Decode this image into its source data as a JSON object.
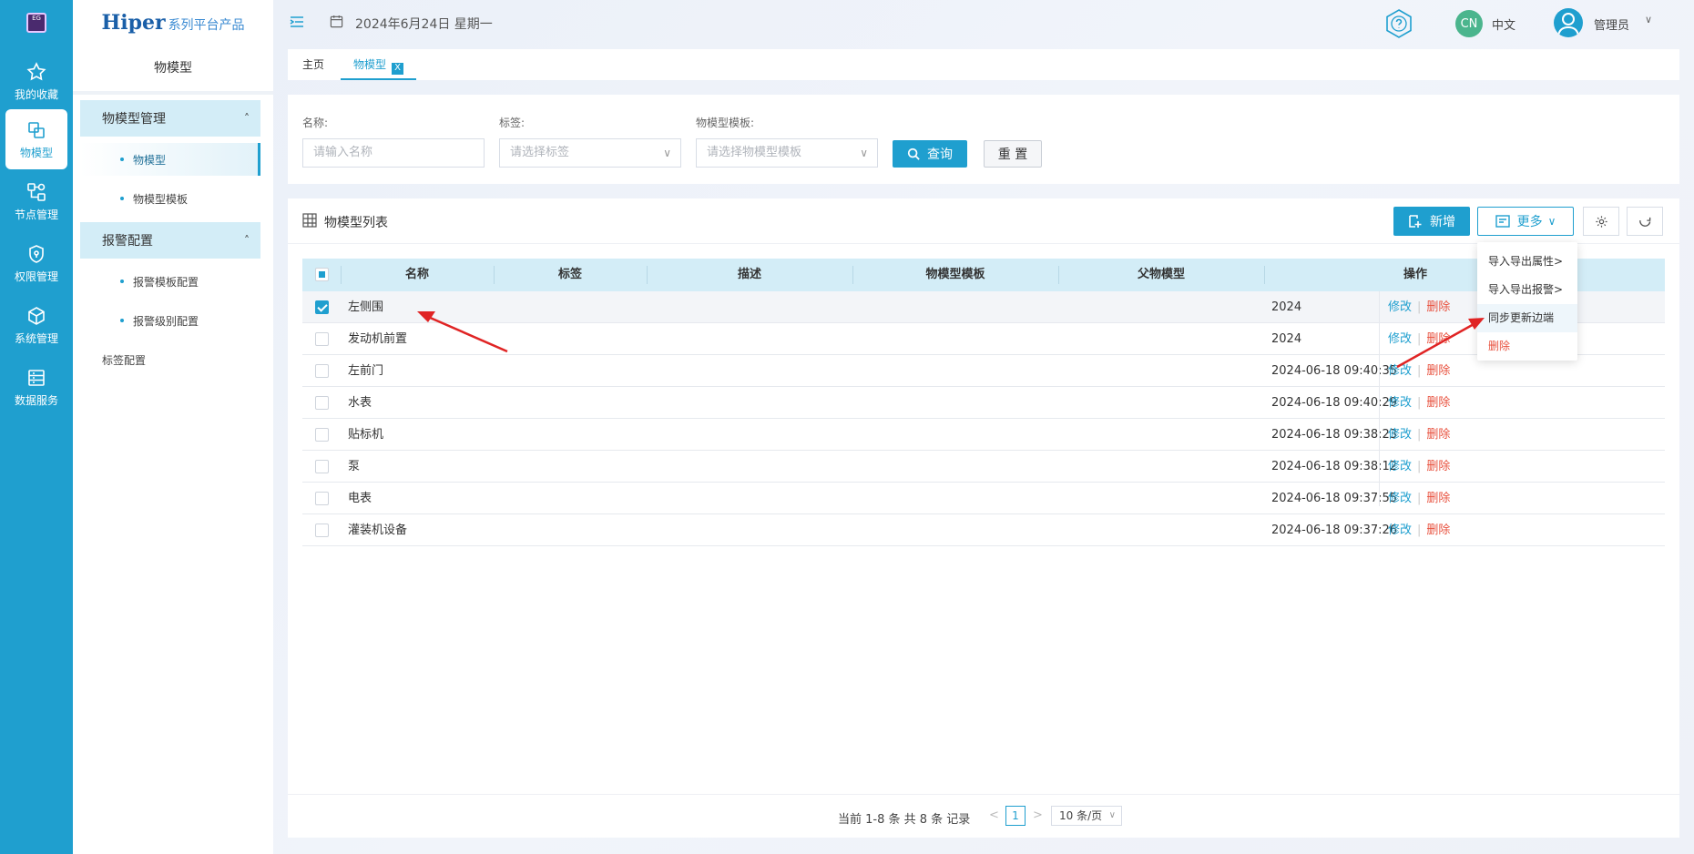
{
  "rail": {
    "items": [
      {
        "label": "我的收藏",
        "icon": "star-icon"
      },
      {
        "label": "物模型",
        "icon": "model-icon"
      },
      {
        "label": "节点管理",
        "icon": "node-icon"
      },
      {
        "label": "权限管理",
        "icon": "shield-icon"
      },
      {
        "label": "系统管理",
        "icon": "cube-icon"
      },
      {
        "label": "数据服务",
        "icon": "database-icon"
      }
    ]
  },
  "brand": {
    "name": "Hiper",
    "suffix": "系列平台产品"
  },
  "sidebar": {
    "title": "物模型",
    "groups": [
      {
        "label": "物模型管理",
        "items": [
          "物模型",
          "物模型模板"
        ]
      },
      {
        "label": "报警配置",
        "items": [
          "报警模板配置",
          "报警级别配置"
        ]
      }
    ],
    "extra": "标签配置"
  },
  "topbar": {
    "date": "2024年6月24日 星期一",
    "cn_badge": "CN",
    "lang": "中文",
    "user": "管理员"
  },
  "tabs": [
    {
      "label": "主页"
    },
    {
      "label": "物模型",
      "close": "X"
    }
  ],
  "filter": {
    "name_label": "名称:",
    "name_placeholder": "请输入名称",
    "tag_label": "标签:",
    "tag_placeholder": "请选择标签",
    "tpl_label": "物模型模板:",
    "tpl_placeholder": "请选择物模型模板",
    "query": "查询",
    "reset": "重 置"
  },
  "list": {
    "title": "物模型列表",
    "add": "新增",
    "more": "更多",
    "columns": [
      "名称",
      "标签",
      "描述",
      "物模型模板",
      "父物模型",
      "操作"
    ],
    "rows": [
      {
        "name": "左侧围",
        "time": "2024",
        "checked": true
      },
      {
        "name": "发动机前置",
        "time": "2024",
        "checked": false
      },
      {
        "name": "左前门",
        "time": "2024-06-18 09:40:35",
        "checked": false
      },
      {
        "name": "水表",
        "time": "2024-06-18 09:40:29",
        "checked": false
      },
      {
        "name": "贴标机",
        "time": "2024-06-18 09:38:23",
        "checked": false
      },
      {
        "name": "泵",
        "time": "2024-06-18 09:38:12",
        "checked": false
      },
      {
        "name": "电表",
        "time": "2024-06-18 09:37:55",
        "checked": false
      },
      {
        "name": "灌装机设备",
        "time": "2024-06-18 09:37:26",
        "checked": false
      }
    ],
    "edit": "修改",
    "sep": "|",
    "delete": "删除"
  },
  "dropdown": {
    "items": [
      {
        "label": "导入导出属性",
        "arrow": ">"
      },
      {
        "label": "导入导出报警",
        "arrow": ">"
      },
      {
        "label": "同步更新边端",
        "arrow": ""
      },
      {
        "label": "删除",
        "arrow": ""
      }
    ]
  },
  "pager": {
    "info": "当前 1-8 条 共 8 条 记录",
    "prev": "<",
    "page": "1",
    "next": ">",
    "size": "10 条/页"
  }
}
